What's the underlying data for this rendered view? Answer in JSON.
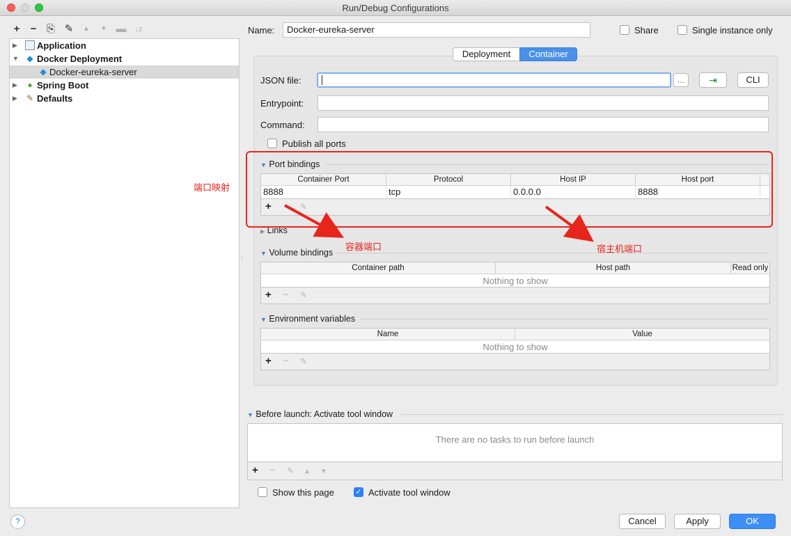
{
  "window": {
    "title": "Run/Debug Configurations"
  },
  "toolbar": {
    "add": "+",
    "remove": "−",
    "copy": "⎘",
    "wrench": "✎",
    "up": "▲",
    "down": "▼",
    "folder": "▬",
    "sort": "↓z"
  },
  "tree": {
    "items": [
      {
        "label": "Application"
      },
      {
        "label": "Docker Deployment"
      },
      {
        "label": "Docker-eureka-server"
      },
      {
        "label": "Spring Boot"
      },
      {
        "label": "Defaults"
      }
    ]
  },
  "header": {
    "name_label": "Name:",
    "name_value": "Docker-eureka-server",
    "share_label": "Share",
    "single_instance_label": "Single instance only"
  },
  "tabs": [
    {
      "label": "Deployment"
    },
    {
      "label": "Container"
    }
  ],
  "container": {
    "json_file_label": "JSON file:",
    "json_file_value": "",
    "browse_label": "...",
    "cli_label": "CLI",
    "entrypoint_label": "Entrypoint:",
    "entrypoint_value": "",
    "command_label": "Command:",
    "command_value": "",
    "publish_all_ports_label": "Publish all ports"
  },
  "port_bindings": {
    "title": "Port bindings",
    "columns": [
      "Container Port",
      "Protocol",
      "Host IP",
      "Host port"
    ],
    "rows": [
      [
        "8888",
        "tcp",
        "0.0.0.0",
        "8888"
      ]
    ]
  },
  "links": {
    "title": "Links"
  },
  "volume_bindings": {
    "title": "Volume bindings",
    "columns": [
      "Container path",
      "Host path",
      "Read only"
    ],
    "empty": "Nothing to show"
  },
  "env_vars": {
    "title": "Environment variables",
    "columns": [
      "Name",
      "Value"
    ],
    "empty": "Nothing to show"
  },
  "before_launch": {
    "title": "Before launch: Activate tool window",
    "empty": "There are no tasks to run before launch"
  },
  "footer": {
    "show_this_page_label": "Show this page",
    "activate_tool_window_label": "Activate tool window",
    "help_label": "?",
    "cancel_label": "Cancel",
    "apply_label": "Apply",
    "ok_label": "OK"
  },
  "annotations": {
    "port_mapping": "端口映射",
    "container_port": "容器端口",
    "host_port": "宿主机端口"
  },
  "colors": {
    "accent": "#2d7ff9",
    "annotation": "#e8251c"
  }
}
